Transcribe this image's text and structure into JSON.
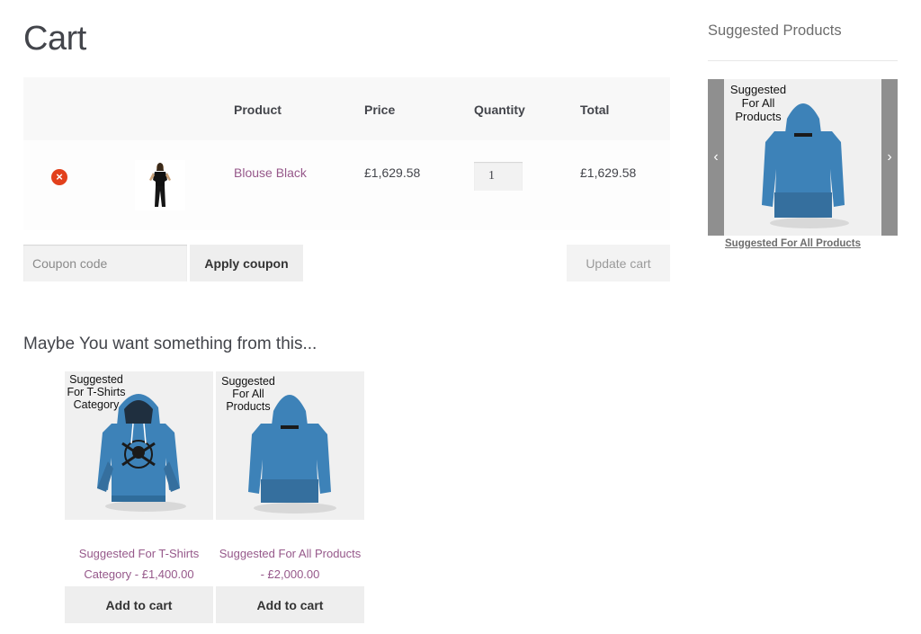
{
  "page": {
    "title": "Cart"
  },
  "cart": {
    "headers": {
      "product": "Product",
      "price": "Price",
      "quantity": "Quantity",
      "total": "Total"
    },
    "rows": [
      {
        "product": "Blouse Black",
        "price": "£1,629.58",
        "quantity": "1",
        "total": "£1,629.58"
      }
    ],
    "coupon_placeholder": "Coupon code",
    "apply_label": "Apply coupon",
    "update_label": "Update cart"
  },
  "crosssell": {
    "heading": "Maybe You want something from this...",
    "products": [
      {
        "image_label_1": "Suggested",
        "image_label_2": "For T-Shirts",
        "image_label_3": "Category",
        "title_1": "Suggested For T-Shirts",
        "title_2": "Category - £1,400.00",
        "button": "Add to cart"
      },
      {
        "image_label_1": "Suggested",
        "image_label_2": "For All",
        "image_label_3": "Products",
        "title_1": "Suggested For All Products",
        "title_2": "- £2,000.00",
        "button": "Add to cart"
      }
    ]
  },
  "sidebar": {
    "title": "Suggested Products",
    "slide": {
      "label_1": "Suggested",
      "label_2": "For All",
      "label_3": "Products",
      "link": "Suggested For All Products"
    }
  },
  "colors": {
    "accent": "#96588a",
    "remove": "#e2401c",
    "hoodie": "#3d82b8"
  }
}
